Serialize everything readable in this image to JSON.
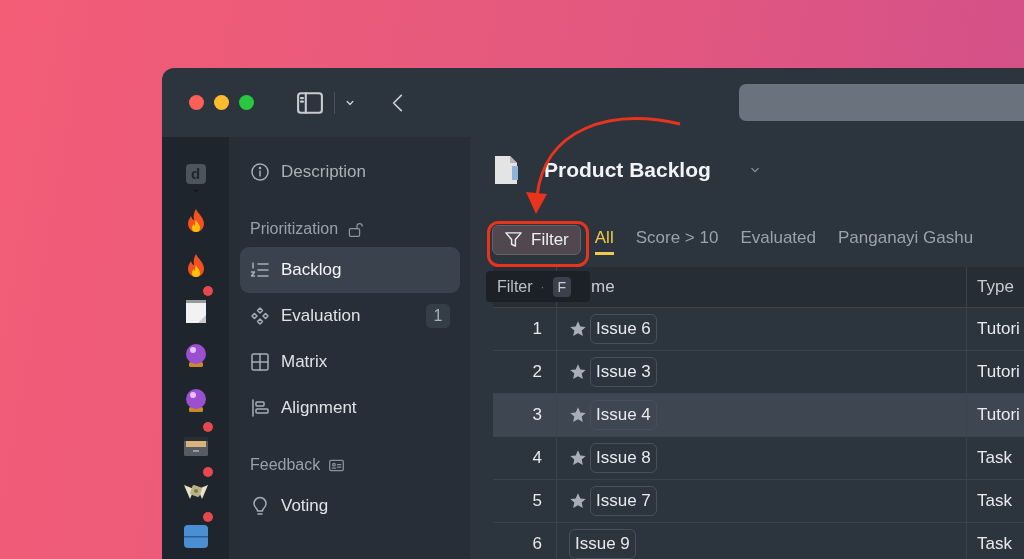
{
  "rail": [
    {
      "kind": "avatar",
      "label": "d",
      "unread": false
    },
    {
      "kind": "flame",
      "unread": false
    },
    {
      "kind": "flame",
      "unread": false
    },
    {
      "kind": "notepad",
      "unread": true
    },
    {
      "kind": "crystal_ball",
      "unread": false
    },
    {
      "kind": "crystal_ball",
      "unread": false
    },
    {
      "kind": "box",
      "unread": true
    },
    {
      "kind": "money",
      "unread": true
    },
    {
      "kind": "numbers",
      "unread": true
    }
  ],
  "sidebar": {
    "sections": [
      {
        "items": [
          {
            "label": "Description",
            "selected": false
          }
        ]
      },
      {
        "title": "Prioritization",
        "items": [
          {
            "label": "Backlog",
            "selected": true
          },
          {
            "label": "Evaluation",
            "badge": "1",
            "selected": false
          },
          {
            "label": "Matrix",
            "selected": false
          },
          {
            "label": "Alignment",
            "selected": false
          }
        ]
      },
      {
        "title": "Feedback",
        "items": [
          {
            "label": "Voting",
            "selected": false
          }
        ]
      }
    ]
  },
  "main": {
    "title": "Product Backlog",
    "filter_button": "Filter",
    "tooltip": {
      "label": "Filter",
      "separator": "·",
      "key": "F"
    },
    "tabs": [
      {
        "label": "All",
        "selected": true
      },
      {
        "label": "Score > 10",
        "selected": false
      },
      {
        "label": "Evaluated",
        "selected": false
      },
      {
        "label": "Panganayi Gashu",
        "selected": false
      }
    ],
    "table": {
      "columns": [
        "me",
        "Type"
      ],
      "rows": [
        {
          "index": "1",
          "starred": true,
          "name": "Issue 6",
          "type": "Tutori",
          "highlighted": false
        },
        {
          "index": "2",
          "starred": true,
          "name": "Issue 3",
          "type": "Tutori",
          "highlighted": false
        },
        {
          "index": "3",
          "starred": true,
          "name": "Issue 4",
          "type": "Tutori",
          "highlighted": true
        },
        {
          "index": "4",
          "starred": true,
          "name": "Issue 8",
          "type": "Task",
          "highlighted": false
        },
        {
          "index": "5",
          "starred": true,
          "name": "Issue 7",
          "type": "Task",
          "highlighted": false
        },
        {
          "index": "6",
          "starred": false,
          "name": "Issue 9",
          "type": "Task",
          "highlighted": false
        }
      ]
    }
  }
}
